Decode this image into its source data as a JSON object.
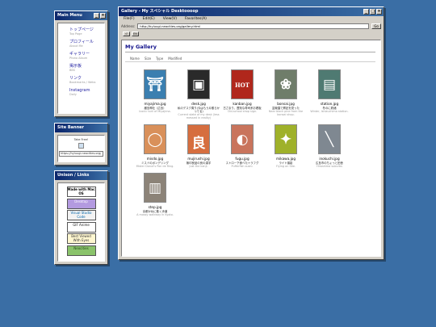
{
  "menu_panel": {
    "title": "Main Menu",
    "items": [
      {
        "label": "トップページ",
        "sub": "Top Page"
      },
      {
        "label": "プロフィール",
        "sub": "About Me"
      },
      {
        "label": "ギャラリー",
        "sub": "Photo Album"
      },
      {
        "label": "掲示板",
        "sub": "BBS"
      },
      {
        "label": "リンク",
        "sub": "Bookmarks / Webs"
      },
      {
        "label": "Instagram",
        "sub": "Daily"
      }
    ]
  },
  "banner_panel": {
    "title": "Site Banner",
    "caption": "Take Free!",
    "url": "https://hyluugi.neocities.org/"
  },
  "links_panel": {
    "title": "Unison / Links",
    "badges": [
      {
        "text": "Made with Mac OS",
        "icon": "apple-icon"
      },
      {
        "text": "Desktop",
        "icon": "purple-badge-icon"
      },
      {
        "text": "Visual Studio Code",
        "icon": "vscode-icon"
      },
      {
        "text": "GIF Anime",
        "icon": "gif-icon"
      },
      {
        "text": "Best Viewed With Eyes",
        "icon": "eye-icon"
      },
      {
        "text": "Neocities",
        "icon": "leaf-icon"
      }
    ]
  },
  "browser": {
    "title": "Gallery - My スペシャル Desktoooop",
    "menu": [
      "File(F)",
      "Edit(E)",
      "View(V)",
      "Favorites(A)"
    ],
    "address_label": "Address:",
    "address": "http://hyluugi.neocities.org/gallery.html",
    "go_label": "Go",
    "tool_buttons": [
      "↺",
      "EN"
    ],
    "heading": "My Gallery",
    "columns": [
      "Name",
      "Size",
      "Type",
      "Modified"
    ],
    "files": [
      {
        "name": "miyajima.jpg",
        "desc": "厳島神社（広島）",
        "desc2": "Iconic torii of Miyajima.",
        "color": "#3b7fb0",
        "glyph": "⛩"
      },
      {
        "name": "desk.jpg",
        "desc": "私のデスク周り(今はもう片散らかってる)",
        "desc2": "Current state of my desk (less messed in reality)",
        "color": "#2a2a2a",
        "glyph": "▣"
      },
      {
        "name": "kanban.jpg",
        "desc": "古さまり、歴刻な寿司系お看板",
        "desc2": "Old-school shop sign.",
        "color": "#b0271c",
        "glyph": "HOT"
      },
      {
        "name": "bonsai.jpg",
        "desc": "盆栽園で昇記を見った",
        "desc2": "Near black pine from the bonsai shop.",
        "color": "#6f7d6a",
        "glyph": "❀"
      },
      {
        "name": "station.jpg",
        "desc": "冬のに着緒",
        "desc2": "Winter, Ishizuchima station.",
        "color": "#4f7a72",
        "glyph": "▤"
      },
      {
        "name": "misdo.jpg",
        "desc": "ミスドのポンデリング",
        "desc2": "Mister Donut's Pon de Ring.",
        "color": "#d9905a",
        "glyph": "◯"
      },
      {
        "name": "mujirushi.jpg",
        "desc": "無印良品の良の漢字",
        "desc2": "Just the kanji.",
        "color": "#d66e3f",
        "glyph": "良"
      },
      {
        "name": "fugu.jpg",
        "desc": "ストロー下食べたトラフグ",
        "desc2": "Pufferfish sushi.",
        "color": "#c9745c",
        "glyph": "◐"
      },
      {
        "name": "mikawa.jpg",
        "desc": "ライト撮影",
        "desc2": "Flying on Site.",
        "color": "#9fb12a",
        "glyph": "✦"
      },
      {
        "name": "inokuchi.jpg",
        "desc": "広島市のちょっと田舎",
        "desc2": "Hiroshima suburbs",
        "color": "#7f8891",
        "glyph": "╲"
      },
      {
        "name": "step.jpg",
        "desc": "京都かねに散く歩道",
        "desc2": "A mossy walkway in Kyoto.",
        "color": "#8c8378",
        "glyph": "▥"
      }
    ]
  }
}
